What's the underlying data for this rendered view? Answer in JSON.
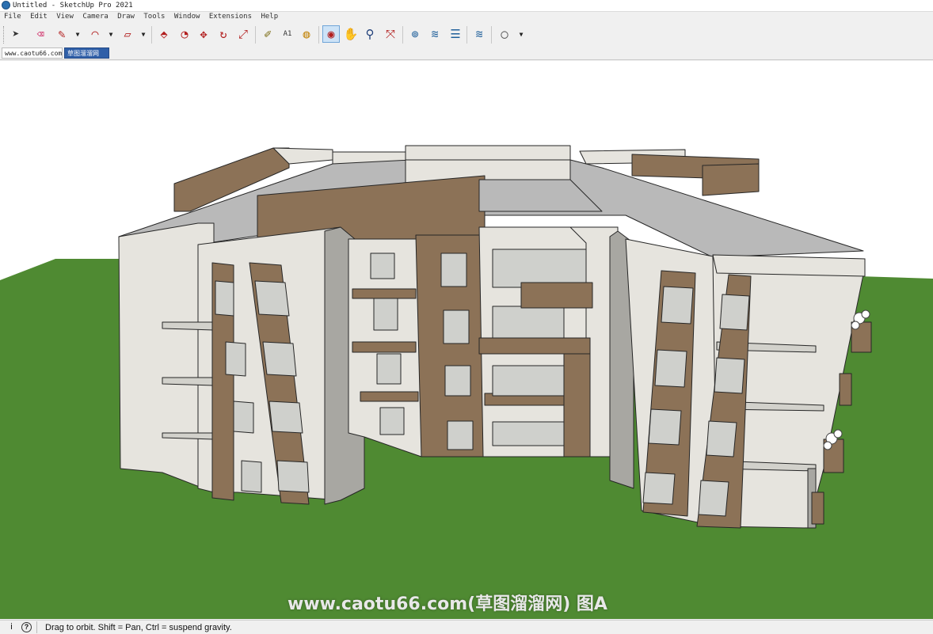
{
  "window": {
    "title": "Untitled - SketchUp Pro 2021"
  },
  "menu": {
    "items": [
      "File",
      "Edit",
      "View",
      "Camera",
      "Draw",
      "Tools",
      "Window",
      "Extensions",
      "Help"
    ]
  },
  "toolbar": {
    "dropdown_glyph": "▼",
    "tools": [
      {
        "name": "select-icon",
        "glyph": "➤"
      },
      {
        "name": "eraser-icon",
        "glyph": "⌫"
      },
      {
        "name": "pencil-icon",
        "glyph": "✎"
      },
      {
        "name": "arc-icon",
        "glyph": "◠"
      },
      {
        "name": "rectangle-icon",
        "glyph": "▱"
      },
      {
        "name": "push-pull-icon",
        "glyph": "⬘"
      },
      {
        "name": "follow-me-icon",
        "glyph": "◔"
      },
      {
        "name": "move-icon",
        "glyph": "✥"
      },
      {
        "name": "rotate-icon",
        "glyph": "↻"
      },
      {
        "name": "scale-icon",
        "glyph": "⤢"
      },
      {
        "name": "tape-measure-icon",
        "glyph": "✐"
      },
      {
        "name": "text-icon",
        "glyph": "A1"
      },
      {
        "name": "paint-bucket-icon",
        "glyph": "◍"
      },
      {
        "name": "orbit-icon",
        "glyph": "◉"
      },
      {
        "name": "pan-icon",
        "glyph": "✋"
      },
      {
        "name": "zoom-icon",
        "glyph": "⚲"
      },
      {
        "name": "zoom-extents-icon",
        "glyph": "⤧"
      },
      {
        "name": "warehouse-icon",
        "glyph": "⊚"
      },
      {
        "name": "extension-warehouse-icon",
        "glyph": "≋"
      },
      {
        "name": "layout-icon",
        "glyph": "☰"
      },
      {
        "name": "extension-manager-icon",
        "glyph": "≋"
      },
      {
        "name": "account-icon",
        "glyph": "◯"
      }
    ]
  },
  "tabs": [
    {
      "label": "www.caotu66.com",
      "active": false
    },
    {
      "label": "草图溜溜网",
      "active": true
    }
  ],
  "viewport": {
    "watermark": "www.caotu66.com(草图溜溜网) 图A",
    "colors": {
      "sky": "#ffffff",
      "ground": "#4f8a32",
      "wall_white": "#e6e4de",
      "wall_shadow": "#a8a7a2",
      "wall_brown": "#8c7257",
      "roof": "#b9b9b9",
      "window": "#cfd0cc",
      "outline": "#262626"
    }
  },
  "statusbar": {
    "info_glyph": "i",
    "hint_glyph": "?",
    "message": "Drag to orbit. Shift = Pan, Ctrl = suspend gravity."
  }
}
